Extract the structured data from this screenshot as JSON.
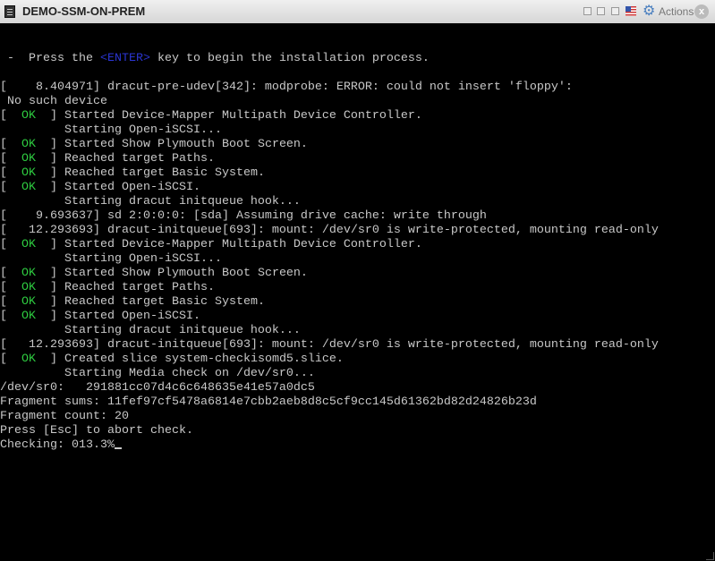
{
  "window": {
    "title": "DEMO-SSM-ON-PREM",
    "actions_label": "Actions",
    "close_label": "x"
  },
  "colors": {
    "ok": "#2ecc40",
    "key": "#2a35d0",
    "text": "#c8c8c8"
  },
  "console": {
    "lines": [
      {
        "row": 2,
        "segs": [
          {
            "t": " -  Press the "
          },
          {
            "t": "<ENTER>",
            "c": "key"
          },
          {
            "t": " key to begin the installation process."
          }
        ]
      },
      {
        "row": 4,
        "segs": [
          {
            "t": "[    8.404971] dracut-pre-udev[342]: modprobe: ERROR: could not insert 'floppy':"
          }
        ]
      },
      {
        "row": 5,
        "segs": [
          {
            "t": " No such device"
          }
        ]
      },
      {
        "row": 6,
        "segs": [
          {
            "t": "[  "
          },
          {
            "t": "OK",
            "c": "ok"
          },
          {
            "t": "  ] Started Device-Mapper Multipath Device Controller."
          }
        ]
      },
      {
        "row": 7,
        "segs": [
          {
            "t": "         Starting Open-iSCSI..."
          }
        ]
      },
      {
        "row": 8,
        "segs": [
          {
            "t": "[  "
          },
          {
            "t": "OK",
            "c": "ok"
          },
          {
            "t": "  ] Started Show Plymouth Boot Screen."
          }
        ]
      },
      {
        "row": 9,
        "segs": [
          {
            "t": "[  "
          },
          {
            "t": "OK",
            "c": "ok"
          },
          {
            "t": "  ] Reached target Paths."
          }
        ]
      },
      {
        "row": 10,
        "segs": [
          {
            "t": "[  "
          },
          {
            "t": "OK",
            "c": "ok"
          },
          {
            "t": "  ] Reached target Basic System."
          }
        ]
      },
      {
        "row": 11,
        "segs": [
          {
            "t": "[  "
          },
          {
            "t": "OK",
            "c": "ok"
          },
          {
            "t": "  ] Started Open-iSCSI."
          }
        ]
      },
      {
        "row": 12,
        "segs": [
          {
            "t": "         Starting dracut initqueue hook..."
          }
        ]
      },
      {
        "row": 13,
        "segs": [
          {
            "t": "[    9.693637] sd 2:0:0:0: [sda] Assuming drive cache: write through"
          }
        ]
      },
      {
        "row": 14,
        "segs": [
          {
            "t": "[   12.293693] dracut-initqueue[693]: mount: /dev/sr0 is write-protected, mounting read-only"
          }
        ]
      },
      {
        "row": 15,
        "segs": [
          {
            "t": "[  "
          },
          {
            "t": "OK",
            "c": "ok"
          },
          {
            "t": "  ] Started Device-Mapper Multipath Device Controller."
          }
        ]
      },
      {
        "row": 16,
        "segs": [
          {
            "t": "         Starting Open-iSCSI..."
          }
        ]
      },
      {
        "row": 17,
        "segs": [
          {
            "t": "[  "
          },
          {
            "t": "OK",
            "c": "ok"
          },
          {
            "t": "  ] Started Show Plymouth Boot Screen."
          }
        ]
      },
      {
        "row": 18,
        "segs": [
          {
            "t": "[  "
          },
          {
            "t": "OK",
            "c": "ok"
          },
          {
            "t": "  ] Reached target Paths."
          }
        ]
      },
      {
        "row": 19,
        "segs": [
          {
            "t": "[  "
          },
          {
            "t": "OK",
            "c": "ok"
          },
          {
            "t": "  ] Reached target Basic System."
          }
        ]
      },
      {
        "row": 20,
        "segs": [
          {
            "t": "[  "
          },
          {
            "t": "OK",
            "c": "ok"
          },
          {
            "t": "  ] Started Open-iSCSI."
          }
        ]
      },
      {
        "row": 21,
        "segs": [
          {
            "t": "         Starting dracut initqueue hook..."
          }
        ]
      },
      {
        "row": 22,
        "segs": [
          {
            "t": "[   12.293693] dracut-initqueue[693]: mount: /dev/sr0 is write-protected, mounting read-only"
          }
        ]
      },
      {
        "row": 23,
        "segs": [
          {
            "t": "[  "
          },
          {
            "t": "OK",
            "c": "ok"
          },
          {
            "t": "  ] Created slice system-checkisomd5.slice."
          }
        ]
      },
      {
        "row": 24,
        "segs": [
          {
            "t": "         Starting Media check on /dev/sr0..."
          }
        ]
      },
      {
        "row": 25,
        "segs": [
          {
            "t": "/dev/sr0:   291881cc07d4c6c648635e41e57a0dc5"
          }
        ]
      },
      {
        "row": 26,
        "segs": [
          {
            "t": "Fragment sums: 11fef97cf5478a6814e7cbb2aeb8d8c5cf9cc145d61362bd82d24826b23d"
          }
        ]
      },
      {
        "row": 27,
        "segs": [
          {
            "t": "Fragment count: 20"
          }
        ]
      },
      {
        "row": 28,
        "segs": [
          {
            "t": "Press [Esc] to abort check."
          }
        ]
      },
      {
        "row": 29,
        "segs": [
          {
            "t": "Checking: 013.3%"
          }
        ],
        "cursor": true
      }
    ]
  }
}
